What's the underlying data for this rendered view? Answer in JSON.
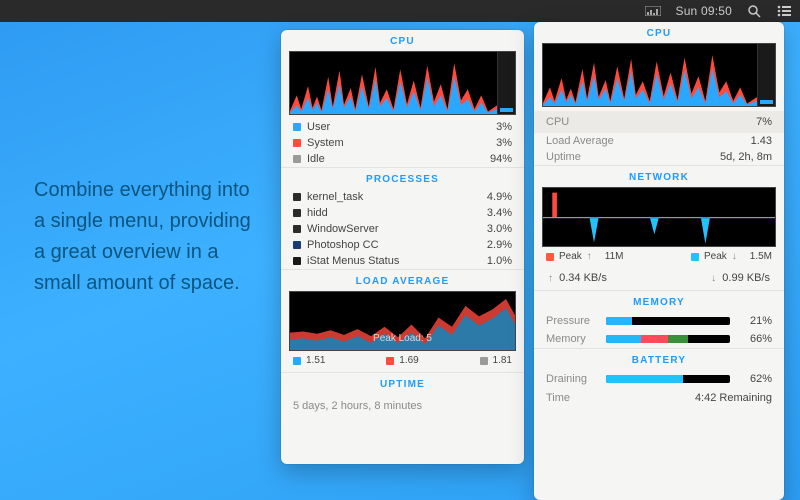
{
  "menubar": {
    "clock": "Sun 09:50"
  },
  "hero": "Combine everything into a single menu, providing a great overview in a small amount of space.",
  "colors": {
    "user": "#2aa8ff",
    "system": "#ff4a3d",
    "idle": "#9a9a98",
    "kernel": "#2b2b2b",
    "hidd": "#2b2b2b",
    "windowserver": "#2b2b2b",
    "photoshop": "#1a3b73",
    "istat": "#1a1a1a",
    "peak_up": "#ff5a3d",
    "peak_dn": "#23c2ff",
    "mem_a": "#26b4ff",
    "mem_b": "#ff4a5a",
    "mem_c": "#3a8f3a",
    "battery": "#1fc1ff"
  },
  "left": {
    "cpu": {
      "title": "CPU",
      "rows": [
        {
          "label": "User",
          "value": "3%",
          "swatch": "user"
        },
        {
          "label": "System",
          "value": "3%",
          "swatch": "system"
        },
        {
          "label": "Idle",
          "value": "94%",
          "swatch": "idle"
        }
      ]
    },
    "processes": {
      "title": "PROCESSES",
      "rows": [
        {
          "label": "kernel_task",
          "value": "4.9%",
          "swatch": "kernel"
        },
        {
          "label": "hidd",
          "value": "3.4%",
          "swatch": "hidd"
        },
        {
          "label": "WindowServer",
          "value": "3.0%",
          "swatch": "windowserver"
        },
        {
          "label": "Photoshop CC",
          "value": "2.9%",
          "swatch": "photoshop"
        },
        {
          "label": "iStat Menus Status",
          "value": "1.0%",
          "swatch": "istat"
        }
      ]
    },
    "load": {
      "title": "LOAD AVERAGE",
      "peak_label": "Peak Load: 5",
      "legend": [
        {
          "swatch": "user",
          "value": "1.51"
        },
        {
          "swatch": "system",
          "value": "1.69"
        },
        {
          "swatch": "idle",
          "value": "1.81"
        }
      ]
    },
    "uptime": {
      "title": "UPTIME",
      "text": "5 days, 2 hours, 8 minutes"
    }
  },
  "right": {
    "cpu": {
      "title": "CPU",
      "row": {
        "label": "CPU",
        "value": "7%"
      },
      "load": {
        "label": "Load Average",
        "value": "1.43"
      },
      "uptime": {
        "label": "Uptime",
        "value": "5d, 2h, 8m"
      }
    },
    "network": {
      "title": "NETWORK",
      "peaks": {
        "up_label": "Peak",
        "up_val": "11M",
        "dn_label": "Peak",
        "dn_val": "1.5M"
      },
      "rates": {
        "up": "0.34 KB/s",
        "down": "0.99 KB/s"
      }
    },
    "memory": {
      "title": "MEMORY",
      "rows": [
        {
          "label": "Pressure",
          "value": "21%",
          "segments": [
            [
              "mem_a",
              21
            ]
          ]
        },
        {
          "label": "Memory",
          "value": "66%",
          "segments": [
            [
              "mem_a",
              28
            ],
            [
              "mem_b",
              22
            ],
            [
              "mem_c",
              16
            ]
          ]
        }
      ]
    },
    "battery": {
      "title": "BATTERY",
      "row": {
        "label": "Draining",
        "value": "62%"
      },
      "time": {
        "label": "Time",
        "value": "4:42 Remaining"
      }
    }
  },
  "chart_data": [
    {
      "type": "area",
      "title": "CPU (left panel)",
      "series": [
        {
          "name": "System",
          "color": "#ff4a3d"
        },
        {
          "name": "User",
          "color": "#2aa8ff"
        }
      ],
      "ylim": [
        0,
        100
      ],
      "note": "decorative sparkline; current values User 3%, System 3%, Idle 94%"
    },
    {
      "type": "area",
      "title": "Load Average",
      "peak": 5,
      "legend_values": {
        "1m": 1.51,
        "5m": 1.69,
        "15m": 1.81
      }
    },
    {
      "type": "area",
      "title": "CPU (right panel)",
      "current_pct": 7
    },
    {
      "type": "area",
      "title": "Network",
      "peaks": {
        "upload": "11M",
        "download": "1.5M"
      },
      "current": {
        "upload": "0.34 KB/s",
        "download": "0.99 KB/s"
      }
    },
    {
      "type": "bar",
      "title": "Memory",
      "categories": [
        "Pressure",
        "Memory"
      ],
      "values": [
        21,
        66
      ]
    },
    {
      "type": "bar",
      "title": "Battery",
      "categories": [
        "Draining"
      ],
      "values": [
        62
      ]
    }
  ]
}
